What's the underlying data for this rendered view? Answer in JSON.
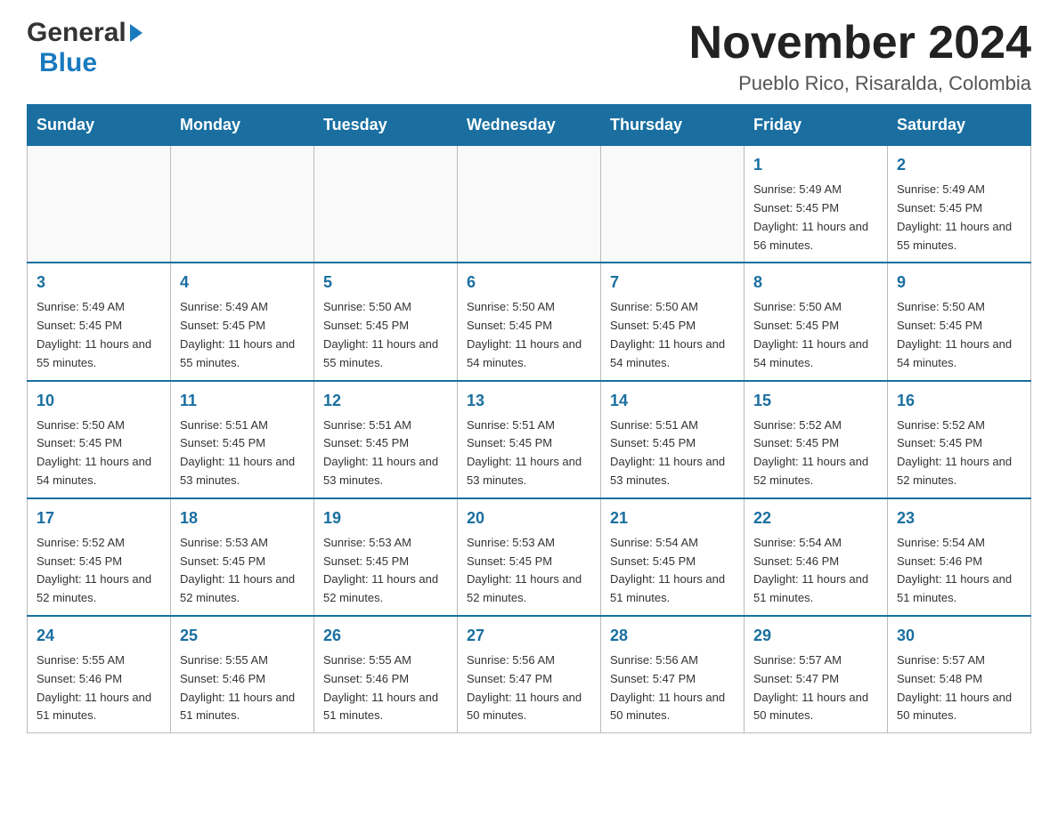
{
  "logo": {
    "general": "General",
    "blue": "Blue"
  },
  "title": {
    "month_year": "November 2024",
    "location": "Pueblo Rico, Risaralda, Colombia"
  },
  "headers": [
    "Sunday",
    "Monday",
    "Tuesday",
    "Wednesday",
    "Thursday",
    "Friday",
    "Saturday"
  ],
  "weeks": [
    [
      {
        "day": "",
        "info": ""
      },
      {
        "day": "",
        "info": ""
      },
      {
        "day": "",
        "info": ""
      },
      {
        "day": "",
        "info": ""
      },
      {
        "day": "",
        "info": ""
      },
      {
        "day": "1",
        "info": "Sunrise: 5:49 AM\nSunset: 5:45 PM\nDaylight: 11 hours and 56 minutes."
      },
      {
        "day": "2",
        "info": "Sunrise: 5:49 AM\nSunset: 5:45 PM\nDaylight: 11 hours and 55 minutes."
      }
    ],
    [
      {
        "day": "3",
        "info": "Sunrise: 5:49 AM\nSunset: 5:45 PM\nDaylight: 11 hours and 55 minutes."
      },
      {
        "day": "4",
        "info": "Sunrise: 5:49 AM\nSunset: 5:45 PM\nDaylight: 11 hours and 55 minutes."
      },
      {
        "day": "5",
        "info": "Sunrise: 5:50 AM\nSunset: 5:45 PM\nDaylight: 11 hours and 55 minutes."
      },
      {
        "day": "6",
        "info": "Sunrise: 5:50 AM\nSunset: 5:45 PM\nDaylight: 11 hours and 54 minutes."
      },
      {
        "day": "7",
        "info": "Sunrise: 5:50 AM\nSunset: 5:45 PM\nDaylight: 11 hours and 54 minutes."
      },
      {
        "day": "8",
        "info": "Sunrise: 5:50 AM\nSunset: 5:45 PM\nDaylight: 11 hours and 54 minutes."
      },
      {
        "day": "9",
        "info": "Sunrise: 5:50 AM\nSunset: 5:45 PM\nDaylight: 11 hours and 54 minutes."
      }
    ],
    [
      {
        "day": "10",
        "info": "Sunrise: 5:50 AM\nSunset: 5:45 PM\nDaylight: 11 hours and 54 minutes."
      },
      {
        "day": "11",
        "info": "Sunrise: 5:51 AM\nSunset: 5:45 PM\nDaylight: 11 hours and 53 minutes."
      },
      {
        "day": "12",
        "info": "Sunrise: 5:51 AM\nSunset: 5:45 PM\nDaylight: 11 hours and 53 minutes."
      },
      {
        "day": "13",
        "info": "Sunrise: 5:51 AM\nSunset: 5:45 PM\nDaylight: 11 hours and 53 minutes."
      },
      {
        "day": "14",
        "info": "Sunrise: 5:51 AM\nSunset: 5:45 PM\nDaylight: 11 hours and 53 minutes."
      },
      {
        "day": "15",
        "info": "Sunrise: 5:52 AM\nSunset: 5:45 PM\nDaylight: 11 hours and 52 minutes."
      },
      {
        "day": "16",
        "info": "Sunrise: 5:52 AM\nSunset: 5:45 PM\nDaylight: 11 hours and 52 minutes."
      }
    ],
    [
      {
        "day": "17",
        "info": "Sunrise: 5:52 AM\nSunset: 5:45 PM\nDaylight: 11 hours and 52 minutes."
      },
      {
        "day": "18",
        "info": "Sunrise: 5:53 AM\nSunset: 5:45 PM\nDaylight: 11 hours and 52 minutes."
      },
      {
        "day": "19",
        "info": "Sunrise: 5:53 AM\nSunset: 5:45 PM\nDaylight: 11 hours and 52 minutes."
      },
      {
        "day": "20",
        "info": "Sunrise: 5:53 AM\nSunset: 5:45 PM\nDaylight: 11 hours and 52 minutes."
      },
      {
        "day": "21",
        "info": "Sunrise: 5:54 AM\nSunset: 5:45 PM\nDaylight: 11 hours and 51 minutes."
      },
      {
        "day": "22",
        "info": "Sunrise: 5:54 AM\nSunset: 5:46 PM\nDaylight: 11 hours and 51 minutes."
      },
      {
        "day": "23",
        "info": "Sunrise: 5:54 AM\nSunset: 5:46 PM\nDaylight: 11 hours and 51 minutes."
      }
    ],
    [
      {
        "day": "24",
        "info": "Sunrise: 5:55 AM\nSunset: 5:46 PM\nDaylight: 11 hours and 51 minutes."
      },
      {
        "day": "25",
        "info": "Sunrise: 5:55 AM\nSunset: 5:46 PM\nDaylight: 11 hours and 51 minutes."
      },
      {
        "day": "26",
        "info": "Sunrise: 5:55 AM\nSunset: 5:46 PM\nDaylight: 11 hours and 51 minutes."
      },
      {
        "day": "27",
        "info": "Sunrise: 5:56 AM\nSunset: 5:47 PM\nDaylight: 11 hours and 50 minutes."
      },
      {
        "day": "28",
        "info": "Sunrise: 5:56 AM\nSunset: 5:47 PM\nDaylight: 11 hours and 50 minutes."
      },
      {
        "day": "29",
        "info": "Sunrise: 5:57 AM\nSunset: 5:47 PM\nDaylight: 11 hours and 50 minutes."
      },
      {
        "day": "30",
        "info": "Sunrise: 5:57 AM\nSunset: 5:48 PM\nDaylight: 11 hours and 50 minutes."
      }
    ]
  ]
}
